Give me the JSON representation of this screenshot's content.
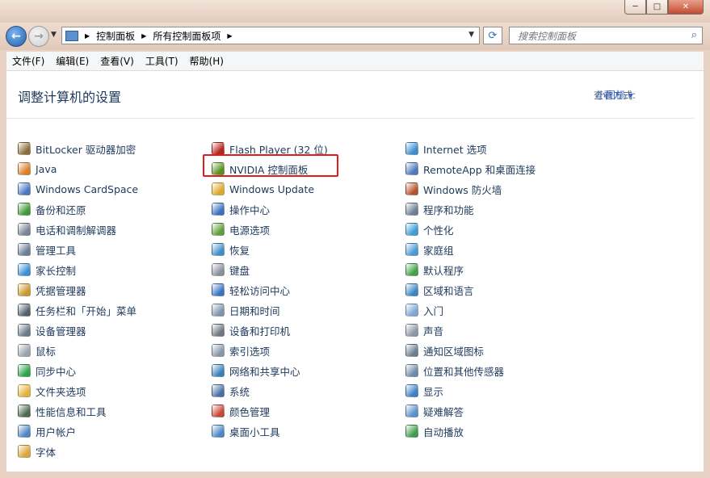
{
  "window": {
    "buttons": {
      "minimize": "─",
      "maximize": "□",
      "close": "✕"
    }
  },
  "nav": {
    "breadcrumbs": [
      "控制面板",
      "所有控制面板项"
    ],
    "search_placeholder": "搜索控制面板"
  },
  "menu": [
    "文件(F)",
    "编辑(E)",
    "查看(V)",
    "工具(T)",
    "帮助(H)"
  ],
  "header": {
    "title": "调整计算机的设置",
    "view_by_label": "查看方式:",
    "view_mode": "小图标 ▾"
  },
  "columns": [
    [
      {
        "label": "BitLocker 驱动器加密",
        "icon": "bitlocker-icon",
        "color": "#8a6d3b"
      },
      {
        "label": "Java",
        "icon": "java-icon",
        "color": "#d9802b"
      },
      {
        "label": "Windows CardSpace",
        "icon": "cardspace-icon",
        "color": "#4a78c2"
      },
      {
        "label": "备份和还原",
        "icon": "backup-icon",
        "color": "#3f9a3a"
      },
      {
        "label": "电话和调制解调器",
        "icon": "phone-modem-icon",
        "color": "#7a8694"
      },
      {
        "label": "管理工具",
        "icon": "admin-tools-icon",
        "color": "#6b7e96"
      },
      {
        "label": "家长控制",
        "icon": "parental-control-icon",
        "color": "#3c8fd6"
      },
      {
        "label": "凭据管理器",
        "icon": "credential-icon",
        "color": "#c99a2e"
      },
      {
        "label": "任务栏和「开始」菜单",
        "icon": "taskbar-icon",
        "color": "#55606e"
      },
      {
        "label": "设备管理器",
        "icon": "device-manager-icon",
        "color": "#6a7a8a"
      },
      {
        "label": "鼠标",
        "icon": "mouse-icon",
        "color": "#9aa3ad"
      },
      {
        "label": "同步中心",
        "icon": "sync-icon",
        "color": "#2fa24a"
      },
      {
        "label": "文件夹选项",
        "icon": "folder-options-icon",
        "color": "#e2b33c"
      },
      {
        "label": "性能信息和工具",
        "icon": "performance-icon",
        "color": "#4d6b52"
      },
      {
        "label": "用户帐户",
        "icon": "user-accounts-icon",
        "color": "#4f86c6"
      },
      {
        "label": "字体",
        "icon": "fonts-icon",
        "color": "#d8a838"
      }
    ],
    [
      {
        "label": "Flash Player (32 位)",
        "icon": "flash-icon",
        "color": "#b2261e"
      },
      {
        "label": "NVIDIA 控制面板",
        "icon": "nvidia-icon",
        "color": "#5a8f1e"
      },
      {
        "label": "Windows Update",
        "icon": "windows-update-icon",
        "color": "#e0a82a"
      },
      {
        "label": "操作中心",
        "icon": "action-center-icon",
        "color": "#3b6fc0"
      },
      {
        "label": "电源选项",
        "icon": "power-icon",
        "color": "#5f9e3a"
      },
      {
        "label": "恢复",
        "icon": "recovery-icon",
        "color": "#3f8fc9"
      },
      {
        "label": "键盘",
        "icon": "keyboard-icon",
        "color": "#8a9099"
      },
      {
        "label": "轻松访问中心",
        "icon": "ease-of-access-icon",
        "color": "#3a74c7"
      },
      {
        "label": "日期和时间",
        "icon": "date-time-icon",
        "color": "#7f93ad"
      },
      {
        "label": "设备和打印机",
        "icon": "printer-icon",
        "color": "#6f7781"
      },
      {
        "label": "索引选项",
        "icon": "indexing-icon",
        "color": "#8796a8"
      },
      {
        "label": "网络和共享中心",
        "icon": "network-icon",
        "color": "#3b7fb8"
      },
      {
        "label": "系统",
        "icon": "system-icon",
        "color": "#4a6fa6"
      },
      {
        "label": "颜色管理",
        "icon": "color-management-icon",
        "color": "#c4473a"
      },
      {
        "label": "桌面小工具",
        "icon": "gadgets-icon",
        "color": "#4d86c8"
      }
    ],
    [
      {
        "label": "Internet 选项",
        "icon": "internet-options-icon",
        "color": "#3e8ed0"
      },
      {
        "label": "RemoteApp 和桌面连接",
        "icon": "remoteapp-icon",
        "color": "#4d7ab8"
      },
      {
        "label": "Windows 防火墙",
        "icon": "firewall-icon",
        "color": "#b4532d"
      },
      {
        "label": "程序和功能",
        "icon": "programs-icon",
        "color": "#6d7f92"
      },
      {
        "label": "个性化",
        "icon": "personalization-icon",
        "color": "#3f9ad8"
      },
      {
        "label": "家庭组",
        "icon": "homegroup-icon",
        "color": "#4b98d2"
      },
      {
        "label": "默认程序",
        "icon": "default-programs-icon",
        "color": "#44a146"
      },
      {
        "label": "区域和语言",
        "icon": "region-language-icon",
        "color": "#3c87c3"
      },
      {
        "label": "入门",
        "icon": "getting-started-icon",
        "color": "#7ea7d3"
      },
      {
        "label": "声音",
        "icon": "sound-icon",
        "color": "#8c96a2"
      },
      {
        "label": "通知区域图标",
        "icon": "notification-icon",
        "color": "#6c7d90"
      },
      {
        "label": "位置和其他传感器",
        "icon": "sensors-icon",
        "color": "#6f8aa8"
      },
      {
        "label": "显示",
        "icon": "display-icon",
        "color": "#3f7fc4"
      },
      {
        "label": "疑难解答",
        "icon": "troubleshooting-icon",
        "color": "#5a8fc8"
      },
      {
        "label": "自动播放",
        "icon": "autoplay-icon",
        "color": "#3f9c4a"
      }
    ]
  ]
}
